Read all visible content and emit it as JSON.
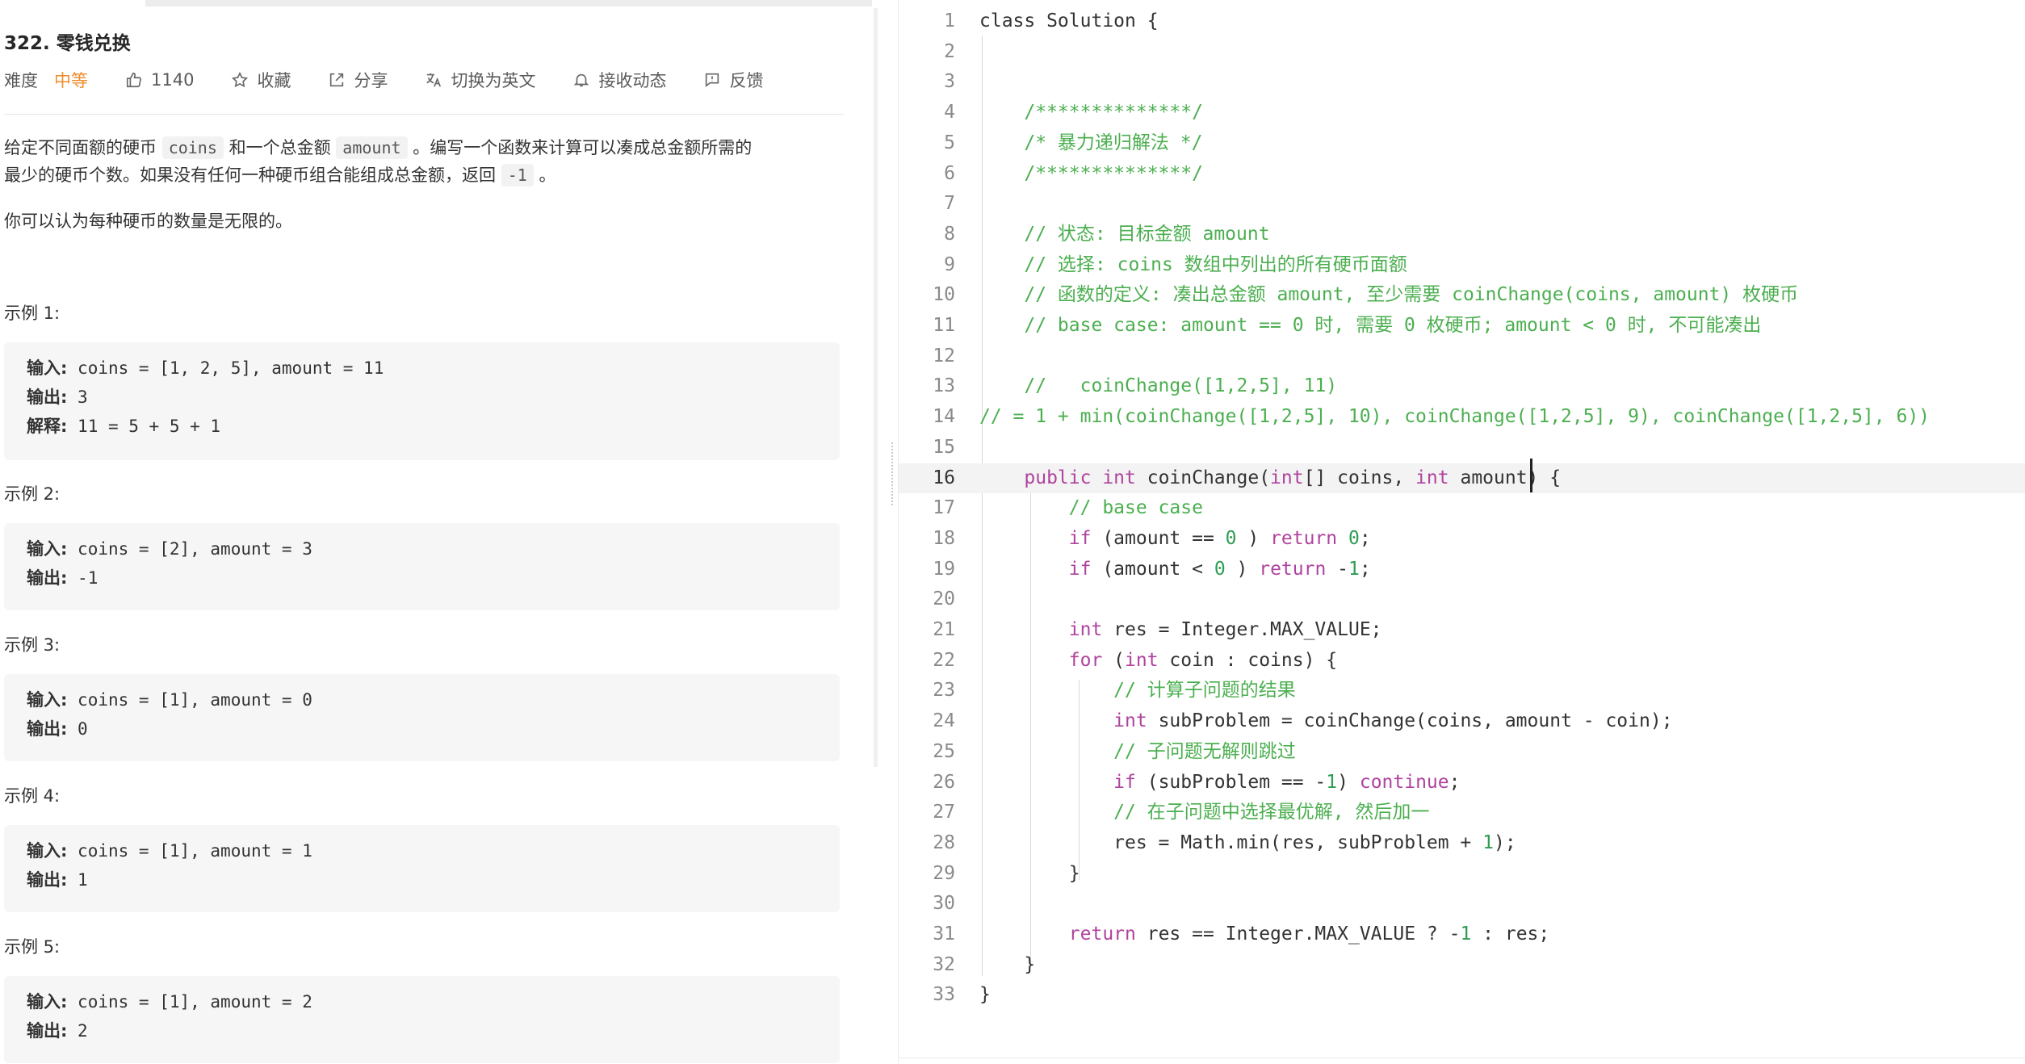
{
  "problem": {
    "title": "322. 零钱兑换",
    "difficulty_label": "难度",
    "difficulty_value": "中等",
    "likes": "1140",
    "favorite": "收藏",
    "share": "分享",
    "switch_lang": "切换为英文",
    "subscribe": "接收动态",
    "feedback": "反馈",
    "desc1_a": "给定不同面额的硬币",
    "desc1_coins": "coins",
    "desc1_b": "和一个总金额",
    "desc1_amount": "amount",
    "desc1_c": "。编写一个函数来计算可以凑成总金额所需的",
    "desc2_a": "最少的硬币个数。如果没有任何一种硬币组合能组成总金额，返回",
    "desc2_neg": "-1",
    "desc2_b": "。",
    "desc3": "你可以认为每种硬币的数量是无限的。",
    "examples": [
      {
        "title": "示例 1:",
        "lines": [
          [
            "输入:",
            " coins = [1, 2, 5], amount = 11"
          ],
          [
            "输出:",
            " 3"
          ],
          [
            "解释:",
            " 11 = 5 + 5 + 1"
          ]
        ]
      },
      {
        "title": "示例 2:",
        "lines": [
          [
            "输入:",
            " coins = [2], amount = 3"
          ],
          [
            "输出:",
            " -1"
          ]
        ]
      },
      {
        "title": "示例 3:",
        "lines": [
          [
            "输入:",
            " coins = [1], amount = 0"
          ],
          [
            "输出:",
            " 0"
          ]
        ]
      },
      {
        "title": "示例 4:",
        "lines": [
          [
            "输入:",
            " coins = [1], amount = 1"
          ],
          [
            "输出:",
            " 1"
          ]
        ]
      },
      {
        "title": "示例 5:",
        "lines": [
          [
            "输入:",
            " coins = [1], amount = 2"
          ],
          [
            "输出:",
            " 2"
          ]
        ]
      }
    ]
  },
  "editor": {
    "active_line": 16,
    "lines": [
      [
        [
          "",
          "class Solution {"
        ]
      ],
      [],
      [],
      [
        [
          "cm",
          "    /**************/"
        ]
      ],
      [
        [
          "cm",
          "    /* 暴力递归解法 */"
        ]
      ],
      [
        [
          "cm",
          "    /**************/"
        ]
      ],
      [],
      [
        [
          "cm",
          "    // 状态: 目标金额 amount"
        ]
      ],
      [
        [
          "cm",
          "    // 选择: coins 数组中列出的所有硬币面额"
        ]
      ],
      [
        [
          "cm",
          "    // 函数的定义: 凑出总金额 amount, 至少需要 coinChange(coins, amount) 枚硬币"
        ]
      ],
      [
        [
          "cm",
          "    // base case: amount == 0 时, 需要 0 枚硬币; amount < 0 时, 不可能凑出"
        ]
      ],
      [],
      [
        [
          "cm",
          "    //   coinChange([1,2,5], 11)"
        ]
      ],
      [
        [
          "cm",
          "// = 1 + min(coinChange([1,2,5], 10), coinChange([1,2,5], 9), coinChange([1,2,5], 6))"
        ]
      ],
      [],
      [
        [
          "",
          "    "
        ],
        [
          "kw",
          "public int"
        ],
        [
          "",
          " coinChange("
        ],
        [
          "kw",
          "int"
        ],
        [
          "",
          "[] coins, "
        ],
        [
          "kw",
          "int"
        ],
        [
          "",
          " amount) {"
        ]
      ],
      [
        [
          "cm",
          "        // base case"
        ]
      ],
      [
        [
          "",
          "        "
        ],
        [
          "kw",
          "if"
        ],
        [
          "",
          " (amount == "
        ],
        [
          "nm",
          "0"
        ],
        [
          "",
          " ) "
        ],
        [
          "kw",
          "return"
        ],
        [
          "",
          " "
        ],
        [
          "nm",
          "0"
        ],
        [
          "",
          ";"
        ]
      ],
      [
        [
          "",
          "        "
        ],
        [
          "kw",
          "if"
        ],
        [
          "",
          " (amount < "
        ],
        [
          "nm",
          "0"
        ],
        [
          "",
          " ) "
        ],
        [
          "kw",
          "return"
        ],
        [
          "",
          " -"
        ],
        [
          "nm",
          "1"
        ],
        [
          "",
          ";"
        ]
      ],
      [],
      [
        [
          "",
          "        "
        ],
        [
          "kw",
          "int"
        ],
        [
          "",
          " res = Integer.MAX_VALUE;"
        ]
      ],
      [
        [
          "",
          "        "
        ],
        [
          "kw",
          "for"
        ],
        [
          "",
          " ("
        ],
        [
          "kw",
          "int"
        ],
        [
          "",
          " coin : coins) {"
        ]
      ],
      [
        [
          "cm",
          "            // 计算子问题的结果"
        ]
      ],
      [
        [
          "",
          "            "
        ],
        [
          "kw",
          "int"
        ],
        [
          "",
          " subProblem = coinChange(coins, amount - coin);"
        ]
      ],
      [
        [
          "cm",
          "            // 子问题无解则跳过"
        ]
      ],
      [
        [
          "",
          "            "
        ],
        [
          "kw",
          "if"
        ],
        [
          "",
          " (subProblem == -"
        ],
        [
          "nm",
          "1"
        ],
        [
          "",
          ") "
        ],
        [
          "kw",
          "continue"
        ],
        [
          "",
          ";"
        ]
      ],
      [
        [
          "cm",
          "            // 在子问题中选择最优解, 然后加一"
        ]
      ],
      [
        [
          "",
          "            res = Math.min(res, subProblem + "
        ],
        [
          "nm",
          "1"
        ],
        [
          "",
          ");"
        ]
      ],
      [
        [
          "",
          "        }"
        ]
      ],
      [],
      [
        [
          "",
          "        "
        ],
        [
          "kw",
          "return"
        ],
        [
          "",
          " res == Integer.MAX_VALUE ? -"
        ],
        [
          "nm",
          "1"
        ],
        [
          "",
          " : res;"
        ]
      ],
      [
        [
          "",
          "    }"
        ]
      ],
      [
        [
          "",
          "}"
        ]
      ]
    ]
  }
}
